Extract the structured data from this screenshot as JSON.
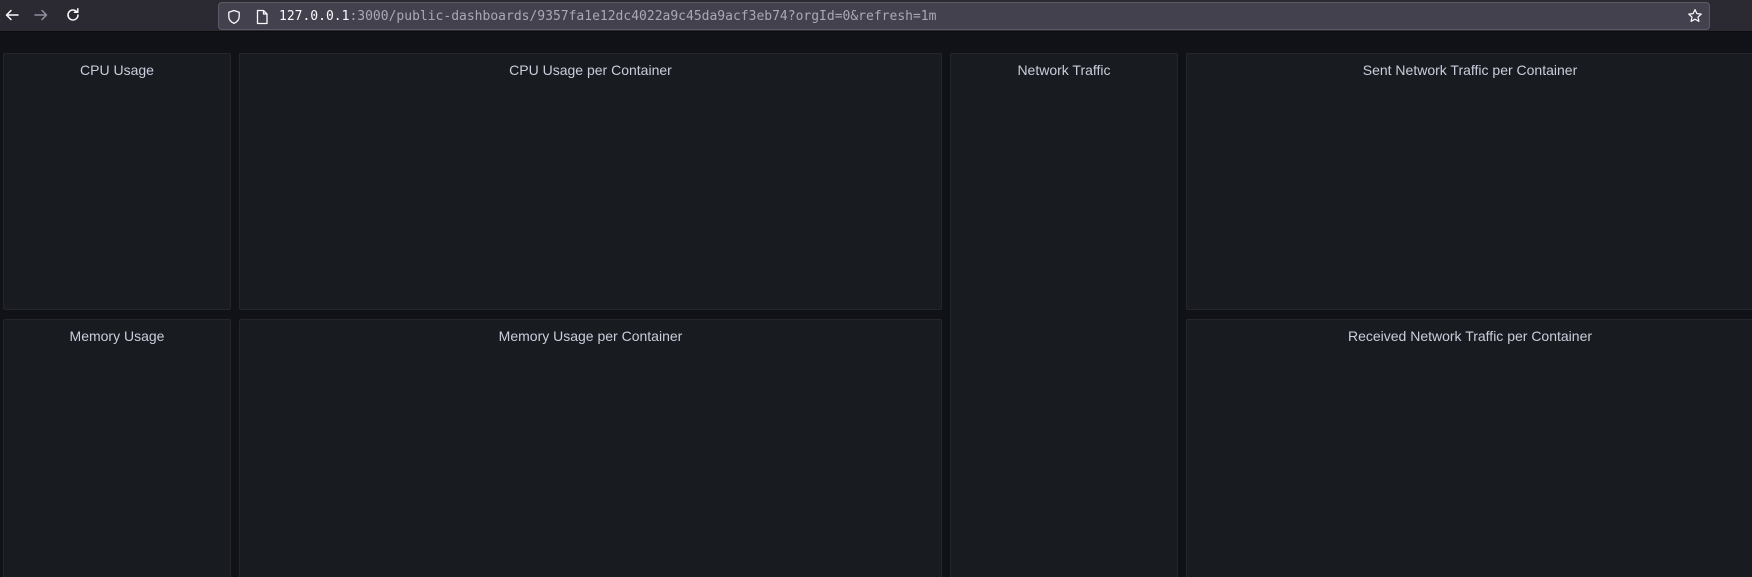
{
  "browser": {
    "url_host": "127.0.0.1",
    "url_rest": ":3000/public-dashboards/9357fa1e12dc4022a9c45da9acf3eb74?orgId=0&refresh=1m",
    "icons": {
      "back": "arrow-left-icon",
      "forward": "arrow-right-icon",
      "reload": "reload-icon",
      "shield": "shield-icon",
      "page": "page-icon",
      "bookmark": "star-icon"
    }
  },
  "dashboard": {
    "panels": {
      "cpu_usage": "CPU Usage",
      "cpu_usage_per_container": "CPU Usage per Container",
      "network_traffic": "Network Traffic",
      "sent_network_traffic_per_container": "Sent Network Traffic per Container",
      "memory_usage": "Memory Usage",
      "memory_usage_per_container": "Memory Usage per Container",
      "received_network_traffic_per_container": "Received Network Traffic per Container"
    }
  }
}
